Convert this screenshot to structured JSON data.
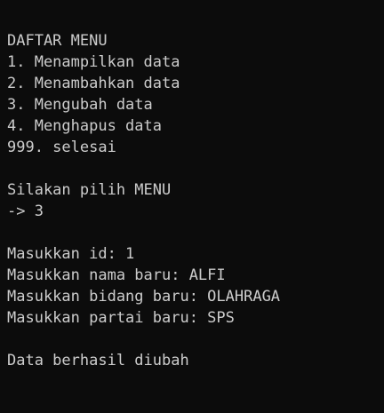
{
  "menu": {
    "title": "DAFTAR MENU",
    "items": [
      "1. Menampilkan data",
      "2. Menambahkan data",
      "3. Mengubah data",
      "4. Menghapus data",
      "999. selesai"
    ]
  },
  "prompt": {
    "text": "Silakan pilih MENU",
    "input": "-> 3"
  },
  "form": {
    "id": "Masukkan id: 1",
    "nama": "Masukkan nama baru: ALFI",
    "bidang": "Masukkan bidang baru: OLAHRAGA",
    "partai": "Masukkan partai baru: SPS"
  },
  "result": {
    "message": "Data berhasil diubah"
  },
  "colors": {
    "background": "#0c0c0c",
    "text": "#cccccc"
  }
}
